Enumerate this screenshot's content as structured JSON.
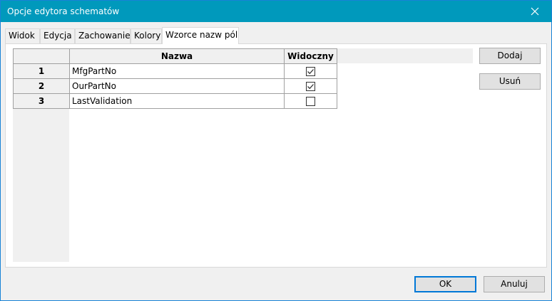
{
  "window": {
    "title": "Opcje edytora schematów"
  },
  "tabs": [
    {
      "label": "Widok"
    },
    {
      "label": "Edycja"
    },
    {
      "label": "Zachowanie"
    },
    {
      "label": "Kolory"
    },
    {
      "label": "Wzorce nazw pól",
      "active": true
    }
  ],
  "grid": {
    "columns": [
      "Nazwa",
      "Widoczny"
    ],
    "rows": [
      {
        "num": "1",
        "name": "MfgPartNo",
        "visible": true
      },
      {
        "num": "2",
        "name": "OurPartNo",
        "visible": true
      },
      {
        "num": "3",
        "name": "LastValidation",
        "visible": false
      }
    ]
  },
  "side_buttons": {
    "add": "Dodaj",
    "remove": "Usuń"
  },
  "footer": {
    "ok": "OK",
    "cancel": "Anuluj"
  },
  "colors": {
    "titlebar": "#0099bc",
    "accent": "#0078d7"
  }
}
